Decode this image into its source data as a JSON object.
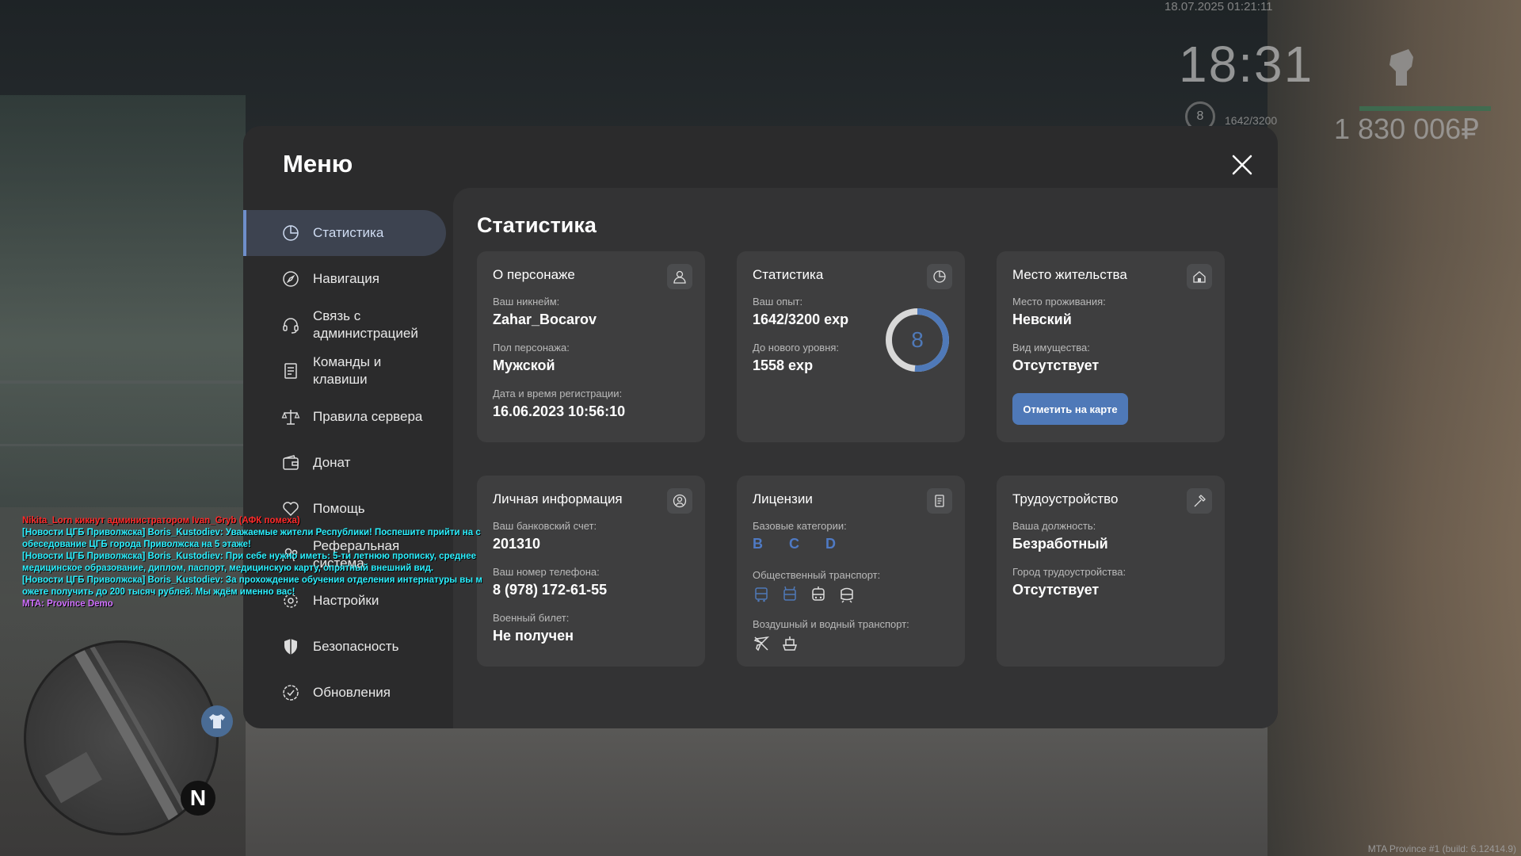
{
  "hud": {
    "date": "18.07.2025 01:21:11",
    "time": "18:31",
    "level": "8",
    "exp": "1642/3200",
    "money": "1 830 006₽",
    "fist_icon": "fist-icon"
  },
  "menu": {
    "title": "Меню",
    "close_icon": "close-icon",
    "nav": [
      {
        "label": "Статистика",
        "icon": "pie-chart-icon",
        "active": true
      },
      {
        "label": "Навигация",
        "icon": "compass-icon"
      },
      {
        "label": "Связь с администрацией",
        "icon": "headset-icon"
      },
      {
        "label": "Команды и клавиши",
        "icon": "document-icon"
      },
      {
        "label": "Правила сервера",
        "icon": "scales-icon"
      },
      {
        "label": "Донат",
        "icon": "wallet-icon"
      },
      {
        "label": "Помощь",
        "icon": "heart-hand-icon"
      },
      {
        "label": "Реферальная система",
        "icon": "users-icon"
      },
      {
        "label": "Настройки",
        "icon": "gear-icon"
      },
      {
        "label": "Безопасность",
        "icon": "shield-icon"
      },
      {
        "label": "Обновления",
        "icon": "badge-check-icon"
      }
    ]
  },
  "content": {
    "title": "Статистика",
    "character": {
      "title": "О персонаже",
      "nickname_label": "Ваш никнейм:",
      "nickname": "Zahar_Bocarov",
      "gender_label": "Пол персонажа:",
      "gender": "Мужской",
      "reg_label": "Дата и время регистрации:",
      "reg": "16.06.2023 10:56:10"
    },
    "stats": {
      "title": "Статистика",
      "exp_label": "Ваш опыт:",
      "exp": "1642/3200 exp",
      "next_label": "До нового уровня:",
      "next": "1558 exp",
      "level": "8",
      "progress": 0.513
    },
    "residence": {
      "title": "Место жительства",
      "place_label": "Место проживания:",
      "place": "Невский",
      "property_label": "Вид имущества:",
      "property": "Отсутствует",
      "button": "Отметить на карте"
    },
    "personal": {
      "title": "Личная информация",
      "bank_label": "Ваш банковский счет:",
      "bank": "201310",
      "phone_label": "Ваш номер телефона:",
      "phone": "8 (978) 172-61-55",
      "military_label": "Военный билет:",
      "military": "Не получен"
    },
    "licenses": {
      "title": "Лицензии",
      "base_label": "Базовые категории:",
      "base": "B C D",
      "public_label": "Общественный транспорт:",
      "public_icons": [
        "bus-icon",
        "trolleybus-icon",
        "tram-icon",
        "metro-icon"
      ],
      "air_label": "Воздушный и водный транспорт:",
      "air_icons": [
        "plane-icon",
        "ship-icon"
      ]
    },
    "job": {
      "title": "Трудоустройство",
      "position_label": "Ваша должность:",
      "position": "Безработный",
      "city_label": "Город трудоустройства:",
      "city": "Отсутствует"
    }
  },
  "chat": [
    {
      "text": "Nikita_Lorn кикнут администратором Ivan_Gryb (АФК помеха)",
      "color": "#ff2a2a"
    },
    {
      "text": "[Новости ЦГБ Приволжска] Boris_Kustodiev: Уважаемые жители Республики! Поспешите прийти на с",
      "color": "#2bf0ff"
    },
    {
      "text": "обеседование ЦГБ города Приволжска на 5 этаже!",
      "color": "#2bf0ff"
    },
    {
      "text": "[Новости ЦГБ Приволжска] Boris_Kustodiev: При себе нужно иметь: 5-ти летнюю прописку, среднее",
      "color": "#2bf0ff"
    },
    {
      "text": "медицинское образование, диплом, паспорт, медицинскую карту, опрятный внешний вид.",
      "color": "#2bf0ff"
    },
    {
      "text": "[Новости ЦГБ Приволжска] Boris_Kustodiev: За прохождение обучения отделения интернатуры вы м",
      "color": "#2bf0ff"
    },
    {
      "text": "ожете получить до 200 тысяч рублей. Мы ждём именно вас!",
      "color": "#2bf0ff"
    },
    {
      "text": "MTA: Province Demo",
      "color": "#d070ff"
    }
  ],
  "minimap": {
    "compass": "N"
  },
  "build": "MTA Province #1 (build: 6.12414.9)"
}
